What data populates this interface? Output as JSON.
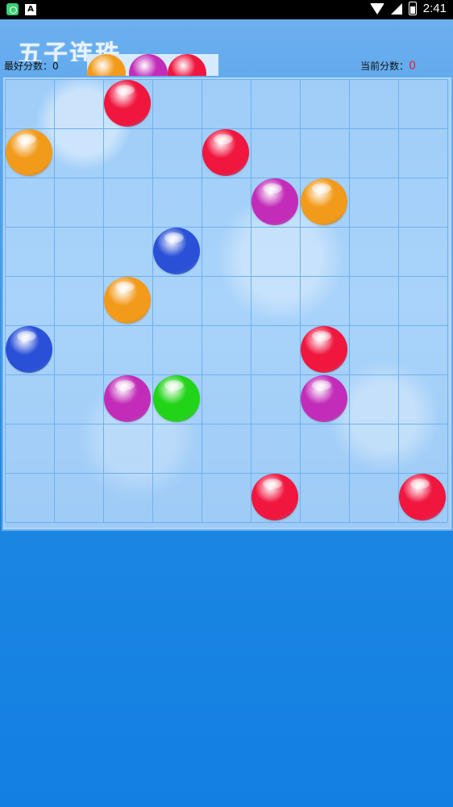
{
  "status_bar": {
    "time": "2:41",
    "a_icon": "A",
    "icons": [
      "app-notification-icon",
      "a-notification-icon",
      "wifi-icon",
      "signal-icon",
      "battery-icon"
    ]
  },
  "header": {
    "title": "五子连珠",
    "best_score_label": "最好分数：0",
    "current_score_label": "当前分数：",
    "current_score_value": "0"
  },
  "next_balls": [
    "orange",
    "purple",
    "red"
  ],
  "board": {
    "rows": 9,
    "cols": 9,
    "balls": [
      {
        "row": 0,
        "col": 2,
        "color": "red"
      },
      {
        "row": 1,
        "col": 0,
        "color": "orange"
      },
      {
        "row": 1,
        "col": 4,
        "color": "red"
      },
      {
        "row": 2,
        "col": 5,
        "color": "purple"
      },
      {
        "row": 2,
        "col": 6,
        "color": "orange"
      },
      {
        "row": 3,
        "col": 3,
        "color": "blue"
      },
      {
        "row": 4,
        "col": 2,
        "color": "orange"
      },
      {
        "row": 5,
        "col": 0,
        "color": "blue"
      },
      {
        "row": 5,
        "col": 6,
        "color": "red"
      },
      {
        "row": 6,
        "col": 2,
        "color": "purple"
      },
      {
        "row": 6,
        "col": 3,
        "color": "green"
      },
      {
        "row": 6,
        "col": 6,
        "color": "purple"
      },
      {
        "row": 8,
        "col": 5,
        "color": "red"
      },
      {
        "row": 8,
        "col": 8,
        "color": "red"
      }
    ]
  },
  "colors": {
    "red": "#f0163e",
    "orange": "#f29a1a",
    "purple": "#c22cb8",
    "blue": "#2a50d8",
    "green": "#22d418",
    "score_value": "#e0203a"
  }
}
